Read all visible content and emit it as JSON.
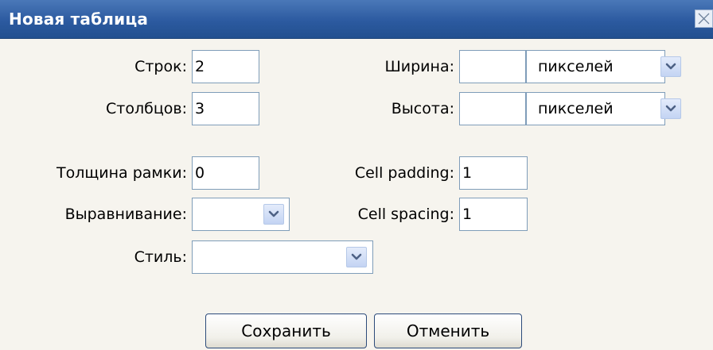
{
  "dialog": {
    "title": "Новая таблица"
  },
  "fields": {
    "rows": {
      "label": "Строк:",
      "value": "2"
    },
    "cols": {
      "label": "Столбцов:",
      "value": "3"
    },
    "width": {
      "label": "Ширина:",
      "value": "",
      "unit": "пикселей"
    },
    "height": {
      "label": "Высота:",
      "value": "",
      "unit": "пикселей"
    },
    "border": {
      "label": "Толщина рамки:",
      "value": "0"
    },
    "cell_padding": {
      "label": "Cell padding:",
      "value": "1"
    },
    "align": {
      "label": "Выравнивание:",
      "value": ""
    },
    "cell_spacing": {
      "label": "Cell spacing:",
      "value": "1"
    },
    "style": {
      "label": "Стиль:",
      "value": ""
    }
  },
  "buttons": {
    "save": "Сохранить",
    "cancel": "Отменить"
  },
  "colors": {
    "titlebar": "#2c5aa0",
    "background": "#f6f4ee",
    "input_border": "#7f9db9"
  },
  "icons": {
    "close": "close-x-icon",
    "dropdown": "chevron-down-icon"
  }
}
